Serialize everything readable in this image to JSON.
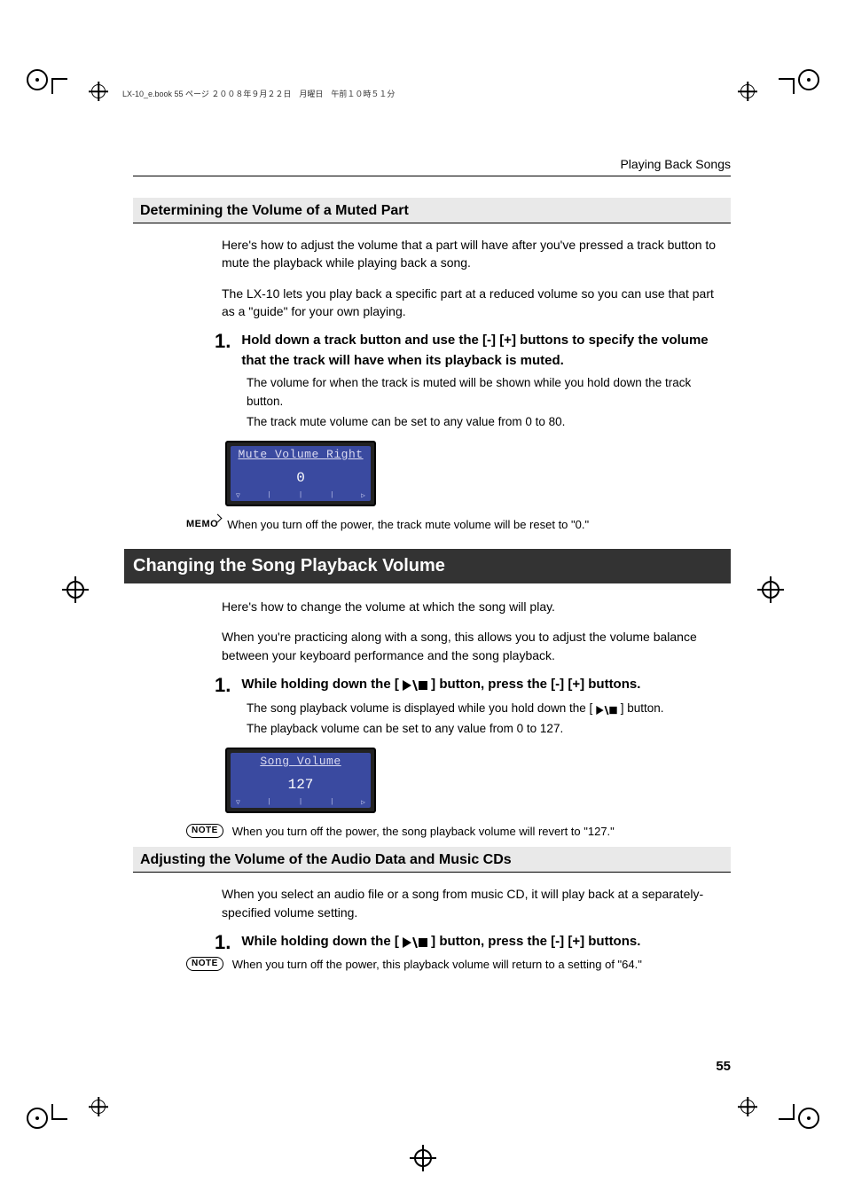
{
  "ebook_line": "LX-10_e.book  55 ページ  ２００８年９月２２日　月曜日　午前１０時５１分",
  "breadcrumb": "Playing Back Songs",
  "page_number": "55",
  "section_mute": {
    "heading": "Determining the Volume of a Muted Part",
    "intro_p1": "Here's how to adjust the volume that a part will have after you've pressed a track button to mute the playback while playing back a song.",
    "intro_p2": "The LX-10 lets you play back a specific part at a reduced volume so you can use that part as a \"guide\" for your own playing.",
    "step_num": "1.",
    "step_text": "Hold down a track button and use the [-] [+] buttons to specify the volume that the track will have when its playback is muted.",
    "step_body1": "The volume for when the track is muted will be shown while you hold down the track button.",
    "step_body2": "The track mute volume can be set to any value from 0 to 80.",
    "lcd_title": "Mute Volume Right",
    "lcd_value": "0",
    "memo_label": "MEMO",
    "memo_text": "When you turn off the power, the track mute volume will be reset to \"0.\""
  },
  "section_song": {
    "banner": "Changing the Song Playback Volume",
    "intro_p1": "Here's how to change the volume at which the song will play.",
    "intro_p2": "When you're practicing along with a song, this allows you to adjust the volume balance between your keyboard performance and the song playback.",
    "step_num": "1.",
    "step_text_a": "While holding down the [",
    "step_text_b": "] button, press the [-] [+] buttons.",
    "step_body1a": "The song playback volume is displayed while you hold down the [",
    "step_body1b": "] button.",
    "step_body2": "The playback volume can be set to any value from 0 to 127.",
    "lcd_title": "Song Volume",
    "lcd_value": "127",
    "note_label": "NOTE",
    "note_text": "When you turn off the power, the song playback volume will revert to \"127.\""
  },
  "section_audio": {
    "heading": "Adjusting the Volume of the Audio Data and Music CDs",
    "intro_p1": "When you select an audio file or a song from music CD, it will play back at a separately-specified volume setting.",
    "step_num": "1.",
    "step_text_a": "While holding down the [",
    "step_text_b": "] button, press the [-] [+] buttons.",
    "note_label": "NOTE",
    "note_text": "When you turn off the power, this playback volume will return to a setting of \"64.\""
  },
  "icons": {
    "playstop": "play-stop-icon"
  }
}
